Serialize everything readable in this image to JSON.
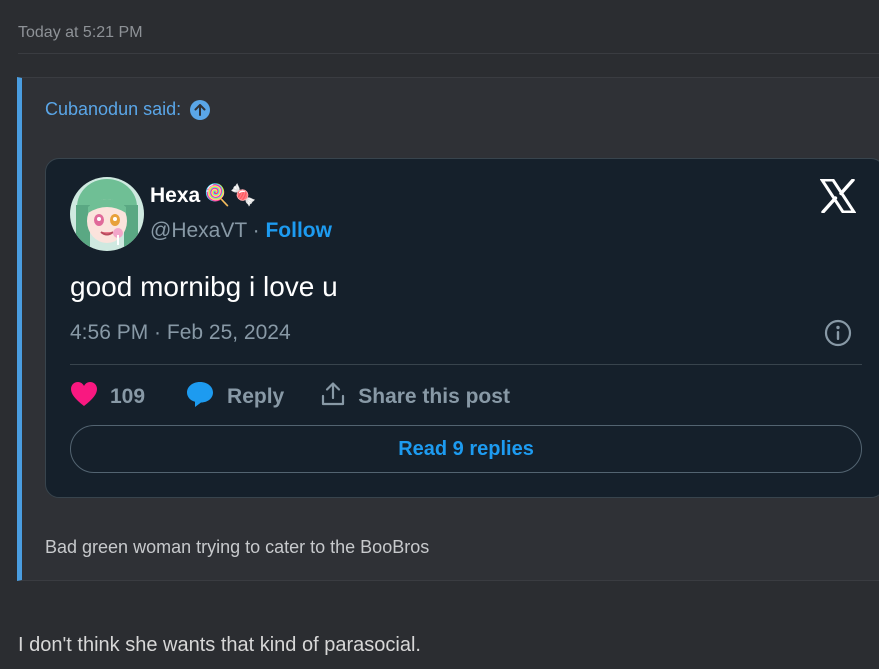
{
  "post": {
    "timestamp": "Today at 5:21 PM",
    "reply_text": "I don't think she wants that kind of parasocial."
  },
  "quote": {
    "author_said": "Cubanodun said:",
    "comment": "Bad green woman trying to cater to the BooBros"
  },
  "tweet": {
    "display_name": "Hexa",
    "name_emojis": "🍭🍬",
    "handle": "@HexaVT",
    "separator": " · ",
    "follow_label": "Follow",
    "text": "good mornibg i love u",
    "time": "4:56 PM · Feb 25, 2024",
    "like_count": "109",
    "reply_label": "Reply",
    "share_label": "Share this post",
    "read_replies_label": "Read 9 replies"
  },
  "colors": {
    "background": "#2b2d31",
    "quote_bar": "#4a9de0",
    "card_bg": "#15202b",
    "link_blue": "#1d9bf0",
    "heart": "#f91880"
  },
  "icons": [
    "up-arrow-icon",
    "x-logo-icon",
    "info-icon",
    "heart-icon",
    "reply-bubble-icon",
    "share-icon"
  ]
}
